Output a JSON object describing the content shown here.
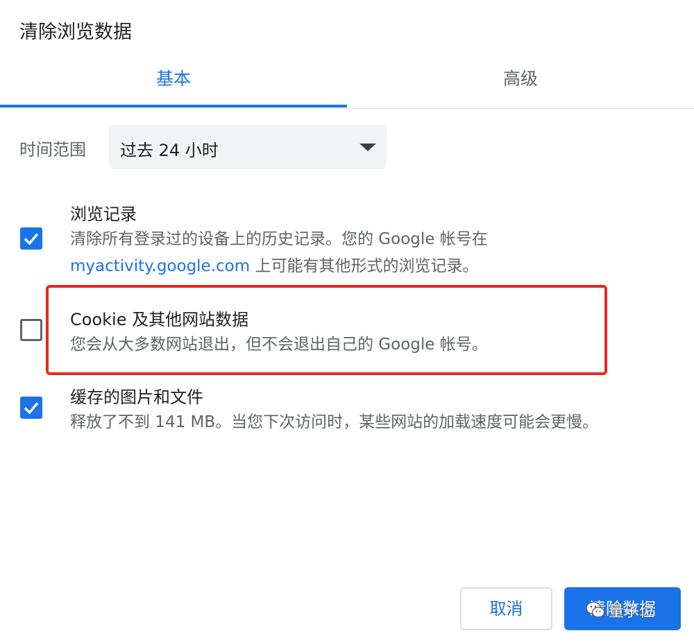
{
  "dialog": {
    "title": "清除浏览数据"
  },
  "tabs": [
    {
      "label": "基本",
      "active": true
    },
    {
      "label": "高级",
      "active": false
    }
  ],
  "time_range": {
    "label": "时间范围",
    "selected": "过去 24 小时"
  },
  "items": [
    {
      "title": "浏览记录",
      "checked": true,
      "desc_line1": "清除所有登录过的设备上的历史记录。您的 Google 帐号在",
      "desc_link": "myactivity.google.com",
      "desc_line2_rest": " 上可能有其他形式的浏览记录。"
    },
    {
      "title": "Cookie 及其他网站数据",
      "checked": false,
      "desc_line1": "您会从大多数网站退出，但不会退出自己的 Google 帐号。"
    },
    {
      "title": "缓存的图片和文件",
      "checked": true,
      "desc_line1": "释放了不到 141 MB。当您下次访问时，某些网站的加载速度可能会更慢。"
    }
  ],
  "buttons": {
    "cancel": "取消",
    "clear": "清除数据"
  },
  "watermark": {
    "text": "量子位"
  },
  "colors": {
    "accent": "#1a73e8",
    "highlight": "#e8281f",
    "text_primary": "#202124",
    "text_secondary": "#5f6368"
  }
}
